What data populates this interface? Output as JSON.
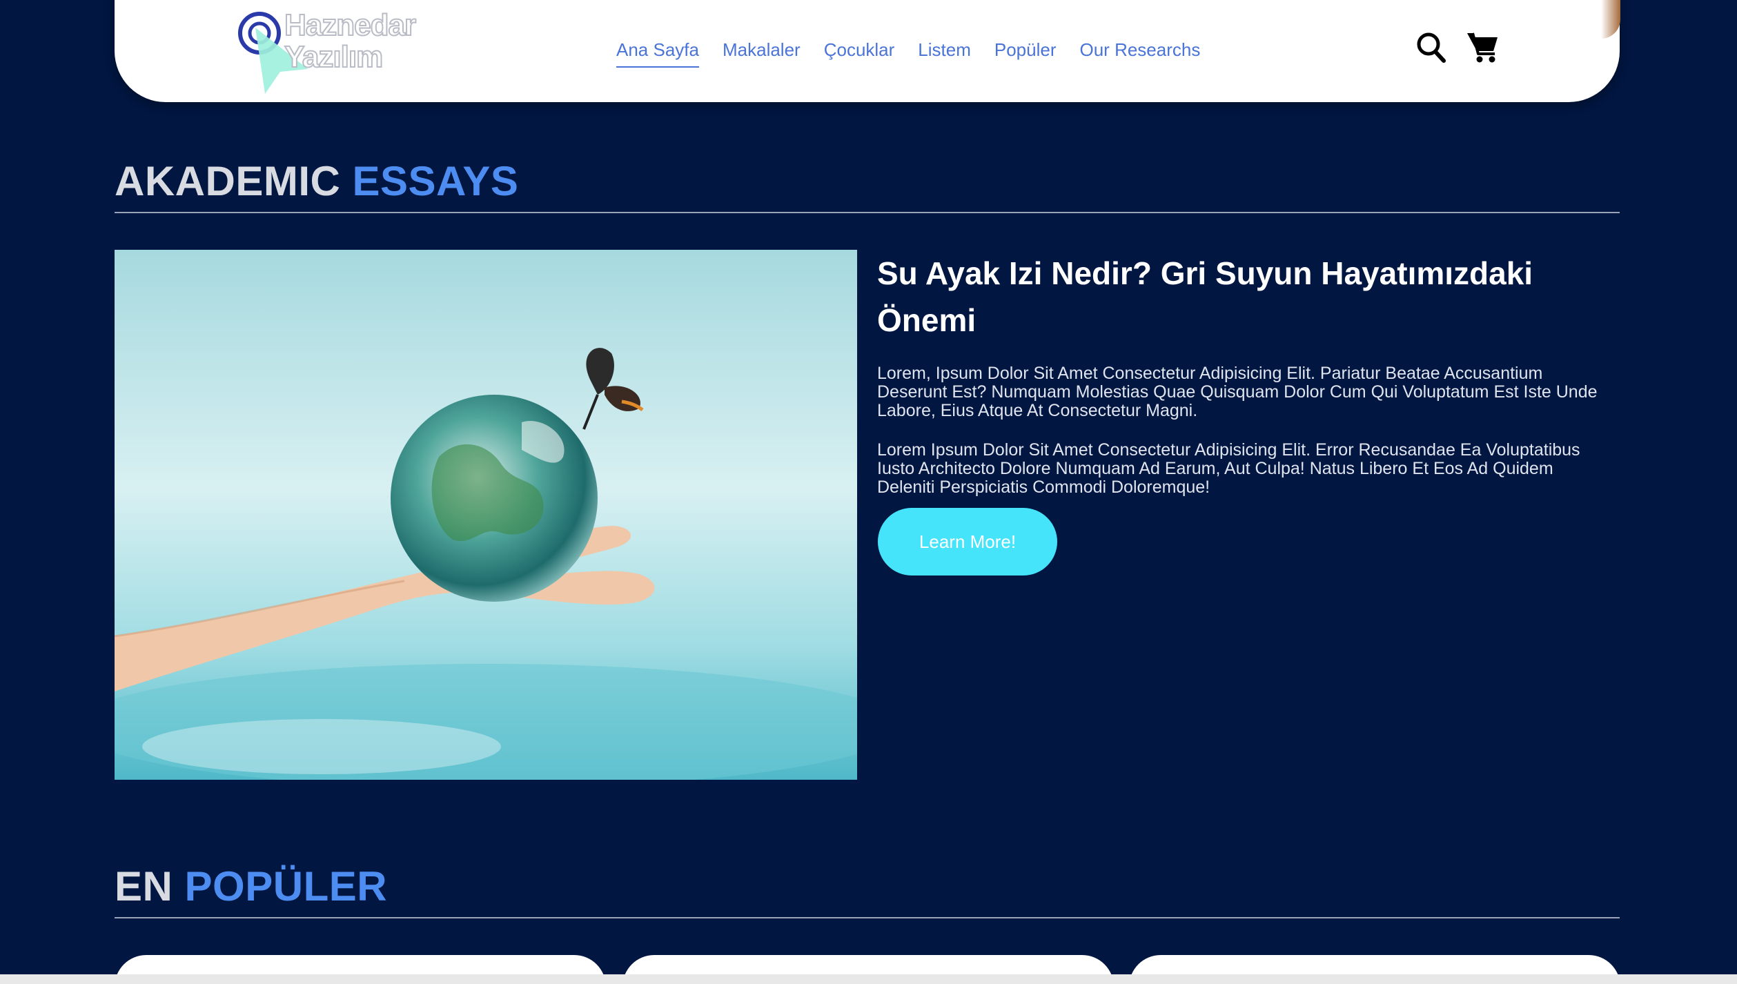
{
  "header": {
    "logo": {
      "line1": "Haznedar",
      "line2": "Yazılım"
    },
    "nav": [
      {
        "label": "Ana Sayfa",
        "active": true
      },
      {
        "label": "Makalaler",
        "active": false
      },
      {
        "label": "Çocuklar",
        "active": false
      },
      {
        "label": "Listem",
        "active": false
      },
      {
        "label": "Popüler",
        "active": false
      },
      {
        "label": "Our Researchs",
        "active": false
      }
    ],
    "icons": {
      "search": "search-icon",
      "cart": "cart-icon"
    }
  },
  "sections": {
    "academic": {
      "title_part1": "AKADEMIC",
      "title_part2": "ESSAYS"
    },
    "popular": {
      "title_part1": "EN",
      "title_part2": "POPÜLER"
    }
  },
  "article": {
    "title": "Su Ayak Izi Nedir? Gri Suyun Hayatımızdaki Önemi",
    "paragraph1": "Lorem, Ipsum Dolor Sit Amet Consectetur Adipisicing Elit. Pariatur Beatae Accusantium Deserunt Est? Numquam Molestias Quae Quisquam Dolor Cum Qui Voluptatum Est Iste Unde Labore, Eius Atque At Consectetur Magni.",
    "paragraph2": "Lorem Ipsum Dolor Sit Amet Consectetur Adipisicing Elit. Error Recusandae Ea Voluptatibus Iusto Architecto Dolore Numquam Ad Earum, Aut Culpa! Natus Libero Et Eos Ad Quidem Deleniti Perspiciatis Commodi Doloremque!",
    "button_label": "Learn More!",
    "image": "hand-holding-earth-with-butterfly"
  },
  "colors": {
    "background": "#011640",
    "accent": "#4d8cf0",
    "nav": "#4a74d6",
    "button": "#45e4fb"
  }
}
